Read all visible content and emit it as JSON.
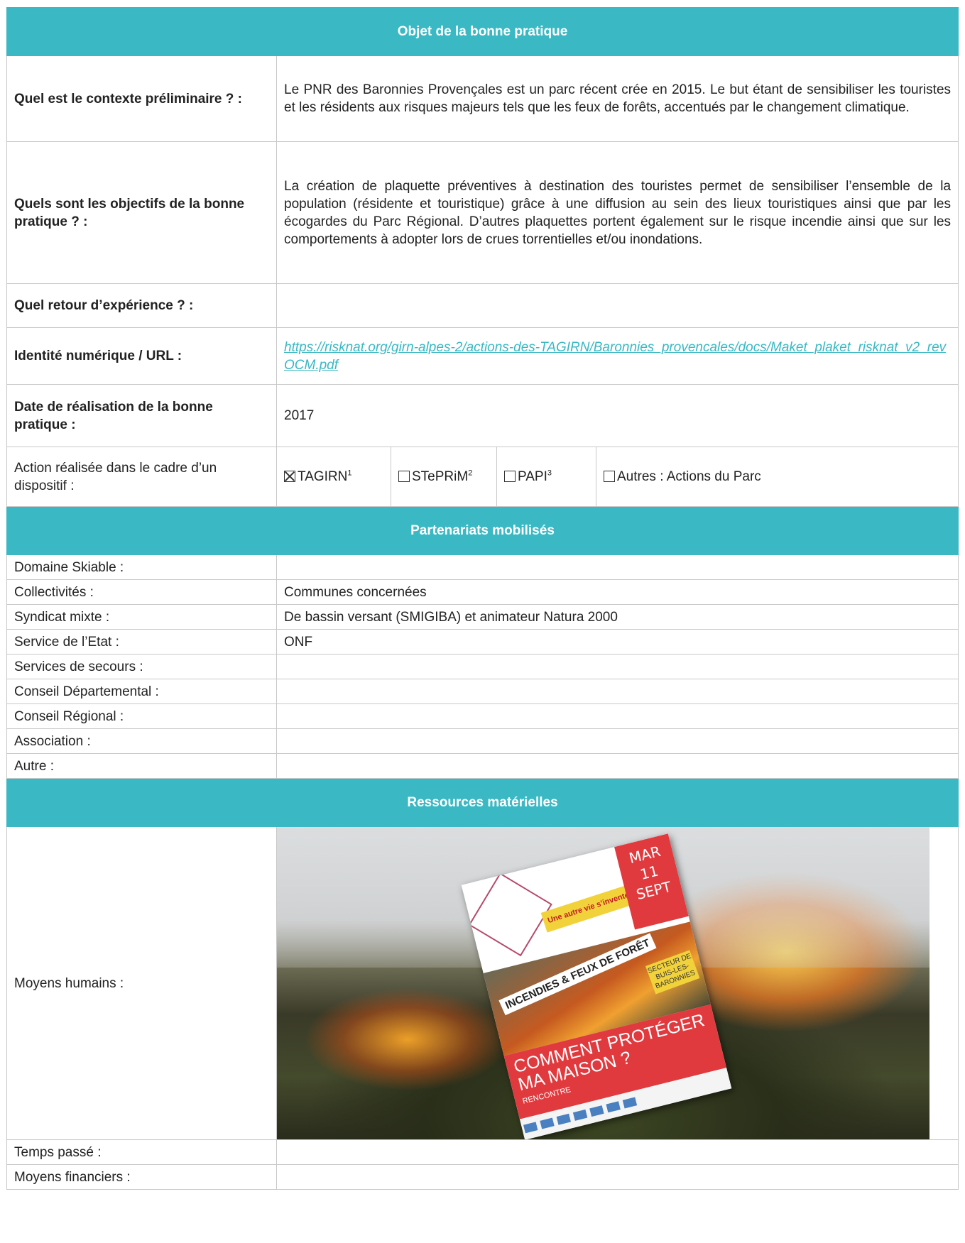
{
  "section_objet": {
    "title": "Objet de la bonne pratique",
    "rows": [
      {
        "label": "Quel est le contexte préliminaire ? :",
        "value": "Le PNR des Baronnies Provençales est un parc récent crée en 2015. Le but étant de sensibiliser les touristes et les résidents aux risques majeurs tels que les feux de forêts, accentués par le changement climatique."
      },
      {
        "label": "Quels sont les objectifs de la bonne pratique ? :",
        "value": "La création de plaquette préventives à destination des touristes permet de sensibiliser l’ensemble de la population (résidente et touristique) grâce à une diffusion au sein des lieux touristiques ainsi que par les écogardes du Parc Régional. D’autres plaquettes portent également sur le risque incendie ainsi que sur les comportements à adopter lors de crues torrentielles et/ou inondations."
      },
      {
        "label": "Quel retour d’expérience ? :",
        "value": ""
      },
      {
        "label": "Identité numérique / URL :",
        "value": "https://risknat.org/girn-alpes-2/actions-des-TAGIRN/Baronnies_provencales/docs/Maket_plaket_risknat_v2_revOCM.pdf"
      },
      {
        "label": "Date de réalisation de la bonne pratique :",
        "value": "2017"
      }
    ],
    "dispositif": {
      "label": "Action réalisée dans le cadre d’un dispositif :",
      "options": [
        {
          "text": "TAGIRN",
          "sup": "1",
          "checked": true
        },
        {
          "text": "STePRiM",
          "sup": "2",
          "checked": false
        },
        {
          "text": "PAPI",
          "sup": "3",
          "checked": false
        },
        {
          "text": "Autres : Actions du Parc",
          "sup": "",
          "checked": false
        }
      ]
    }
  },
  "section_partenariats": {
    "title": "Partenariats mobilisés",
    "rows": [
      {
        "label": "Domaine Skiable :",
        "value": ""
      },
      {
        "label": "Collectivités :",
        "value": "Communes concernées"
      },
      {
        "label": "Syndicat mixte :",
        "value": "De bassin versant (SMIGIBA) et animateur Natura 2000"
      },
      {
        "label": "Service de l’Etat :",
        "value": "ONF"
      },
      {
        "label": "Services de secours :",
        "value": ""
      },
      {
        "label": "Conseil Départemental :",
        "value": ""
      },
      {
        "label": "Conseil Régional :",
        "value": ""
      },
      {
        "label": "Association :",
        "value": ""
      },
      {
        "label": "Autre :",
        "value": ""
      }
    ]
  },
  "section_ressources": {
    "title": "Ressources matérielles",
    "moyens_humains_label": "Moyens humains :",
    "poster": {
      "date_line1": "MAR",
      "date_line2": "11",
      "date_line3": "SEPT",
      "tagline": "Une autre vie s’invente ici",
      "title": "INCENDIES & FEUX DE FORÊT",
      "secteur": "SECTEUR DE BUIS-LES-BARONNIES",
      "main": "COMMENT PROTÉGER MA MAISON ?",
      "sub": "RENCONTRE"
    },
    "rows": [
      {
        "label": "Temps passé :",
        "value": ""
      },
      {
        "label": "Moyens financiers :",
        "value": ""
      }
    ]
  },
  "colors": {
    "header_bg": "#3ab8c3",
    "link": "#3ab8c3"
  }
}
